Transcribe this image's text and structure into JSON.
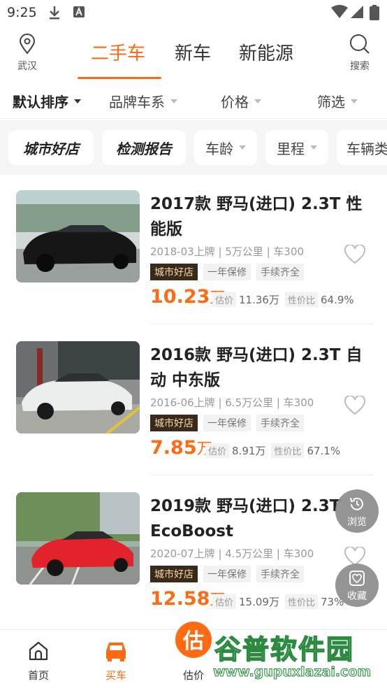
{
  "status_bar": {
    "time": "9:25"
  },
  "top_nav": {
    "location": "武汉",
    "search": "搜索",
    "tabs": [
      {
        "label": "二手车",
        "active": true
      },
      {
        "label": "新车",
        "active": false
      },
      {
        "label": "新能源",
        "active": false
      }
    ]
  },
  "filters": [
    "默认排序",
    "品牌车系",
    "价格",
    "筛选"
  ],
  "chips": [
    "城市好店",
    "检测报告",
    "车龄",
    "里程",
    "车辆类"
  ],
  "listings": [
    {
      "title": "2017款 野马(进口) 2.3T 性能版",
      "meta": "2018-03上牌 | 5万公里 | 车300",
      "tags": [
        "城市好店",
        "一年保修",
        "手续齐全"
      ],
      "price": "10.23",
      "price_unit": "万",
      "est_label": "估价",
      "est_value": "11.36万",
      "ratio_label": "性价比",
      "ratio_value": "64.9%",
      "car_color": "black"
    },
    {
      "title": "2016款 野马(进口) 2.3T 自动 中东版",
      "meta": "2016-06上牌 | 6.5万公里 | 车300",
      "tags": [
        "城市好店",
        "一年保修",
        "手续齐全"
      ],
      "price": "7.85",
      "price_unit": "万",
      "est_label": "估价",
      "est_value": "8.91万",
      "ratio_label": "性价比",
      "ratio_value": "67.1%",
      "car_color": "white"
    },
    {
      "title": "2019款 野马(进口) 2.3T EcoBoost",
      "meta": "2020-07上牌 | 4.5万公里 | 车300",
      "tags": [
        "城市好店",
        "一年保修",
        "手续齐全"
      ],
      "price": "12.58",
      "price_unit": "万",
      "est_label": "估价",
      "est_value": "15.09万",
      "ratio_label": "性价比",
      "ratio_value": "73%",
      "car_color": "red"
    }
  ],
  "floating": {
    "history": "浏览",
    "favorites": "收藏"
  },
  "bottom_nav": {
    "home": "首页",
    "buy": "买车",
    "estimate": "估价",
    "estimate_badge": "估"
  },
  "watermark": {
    "title": "谷普软件园",
    "url": "www.gupuxlazai.com"
  },
  "colors": {
    "accent": "#ff6a13",
    "tag_dark_bg": "#3b2a1c",
    "tag_dark_text": "#f5d9a8"
  }
}
